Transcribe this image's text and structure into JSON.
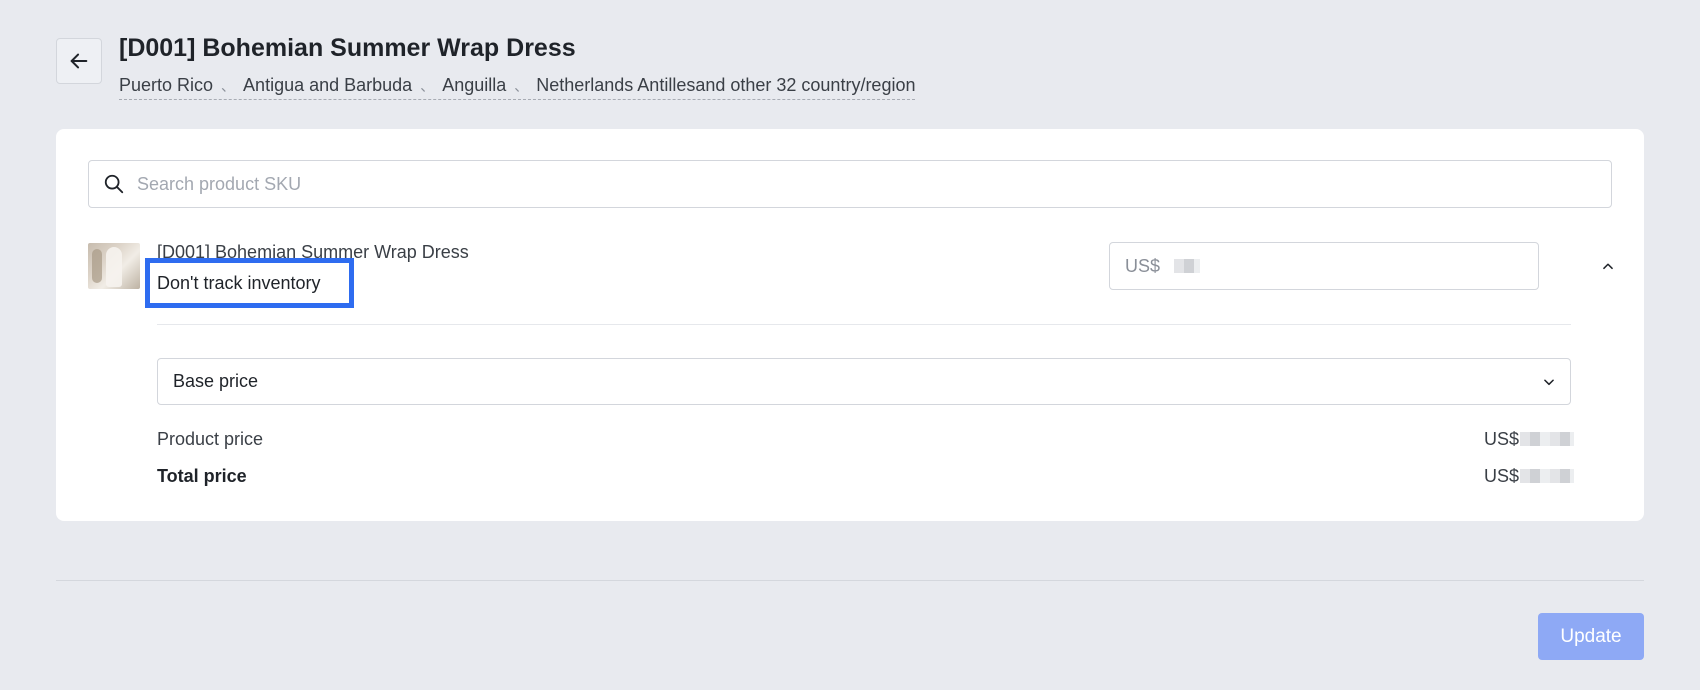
{
  "header": {
    "title": "[D001] Bohemian Summer Wrap Dress",
    "regions": [
      "Puerto Rico",
      "Antigua and Barbuda",
      "Anguilla",
      "Netherlands Antilles"
    ],
    "regions_suffix": "and other 32 country/region",
    "region_separator": "、"
  },
  "search": {
    "placeholder": "Search product SKU",
    "value": ""
  },
  "product": {
    "name": "[D001] Bohemian Summer Wrap Dress",
    "inventory_status": "Don't track inventory",
    "price_currency": "US$"
  },
  "price_type": {
    "selected": "Base price"
  },
  "summary": {
    "product_price_label": "Product price",
    "product_price_currency": "US$",
    "total_price_label": "Total price",
    "total_price_currency": "US$"
  },
  "footer": {
    "update_label": "Update"
  },
  "colors": {
    "accent": "#2e6cf0",
    "update_button_disabled": "#8ea9f5",
    "background": "#e8eaef"
  }
}
